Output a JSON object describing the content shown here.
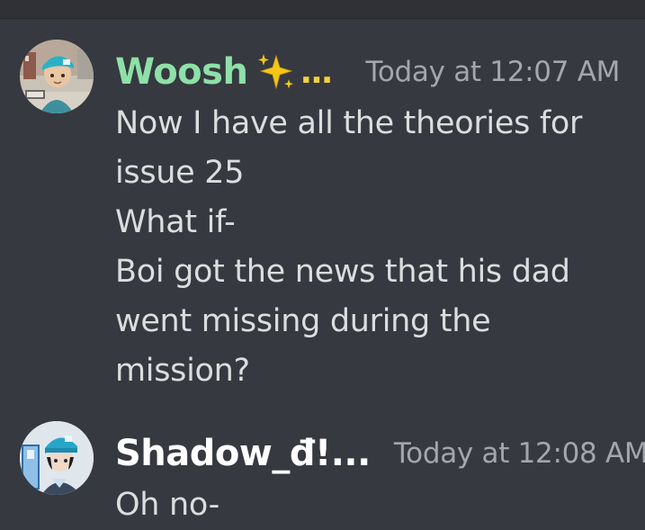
{
  "messages": [
    {
      "author": "Woosh",
      "author_suffix": "...",
      "author_color": "#8ee0a8",
      "timestamp": "Today at 12:07 AM",
      "emoji": "sparkles-icon",
      "lines": [
        "Now I have all the theories for",
        "issue 25",
        "What if-",
        "Boi got the news that his dad",
        "went missing during the",
        "mission?"
      ]
    },
    {
      "author": "Shadow_đ!...",
      "author_color": "#ffffff",
      "timestamp": "Today at 12:08 AM",
      "lines": [
        "Oh no-"
      ]
    }
  ]
}
